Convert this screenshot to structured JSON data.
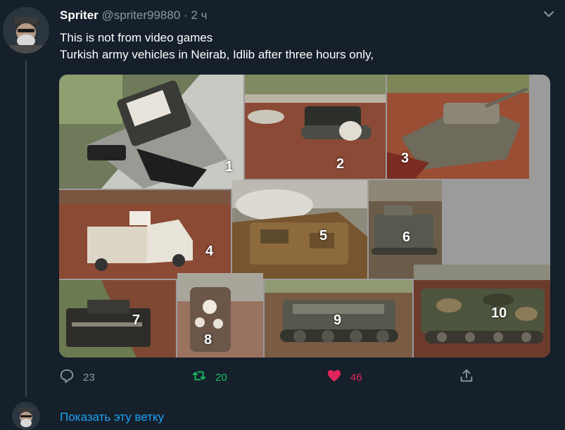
{
  "tweet": {
    "author_name": "Spriter",
    "author_handle": "@spriter99880",
    "separator": "·",
    "time": "2 ч",
    "text_line1": "This is not from video games",
    "text_line2": "Turkish army vehicles in Neirab, Idlib after three hours only,",
    "photo_labels": [
      "1",
      "2",
      "3",
      "4",
      "5",
      "6",
      "7",
      "8",
      "9",
      "10"
    ]
  },
  "actions": {
    "reply_count": "23",
    "retweet_count": "20",
    "like_count": "46"
  },
  "thread": {
    "show_thread_label": "Показать эту ветку"
  },
  "colors": {
    "background": "#15202b",
    "link": "#1da1f2",
    "retweet": "#17bf63",
    "like": "#e0245e",
    "muted": "#8899a6"
  }
}
